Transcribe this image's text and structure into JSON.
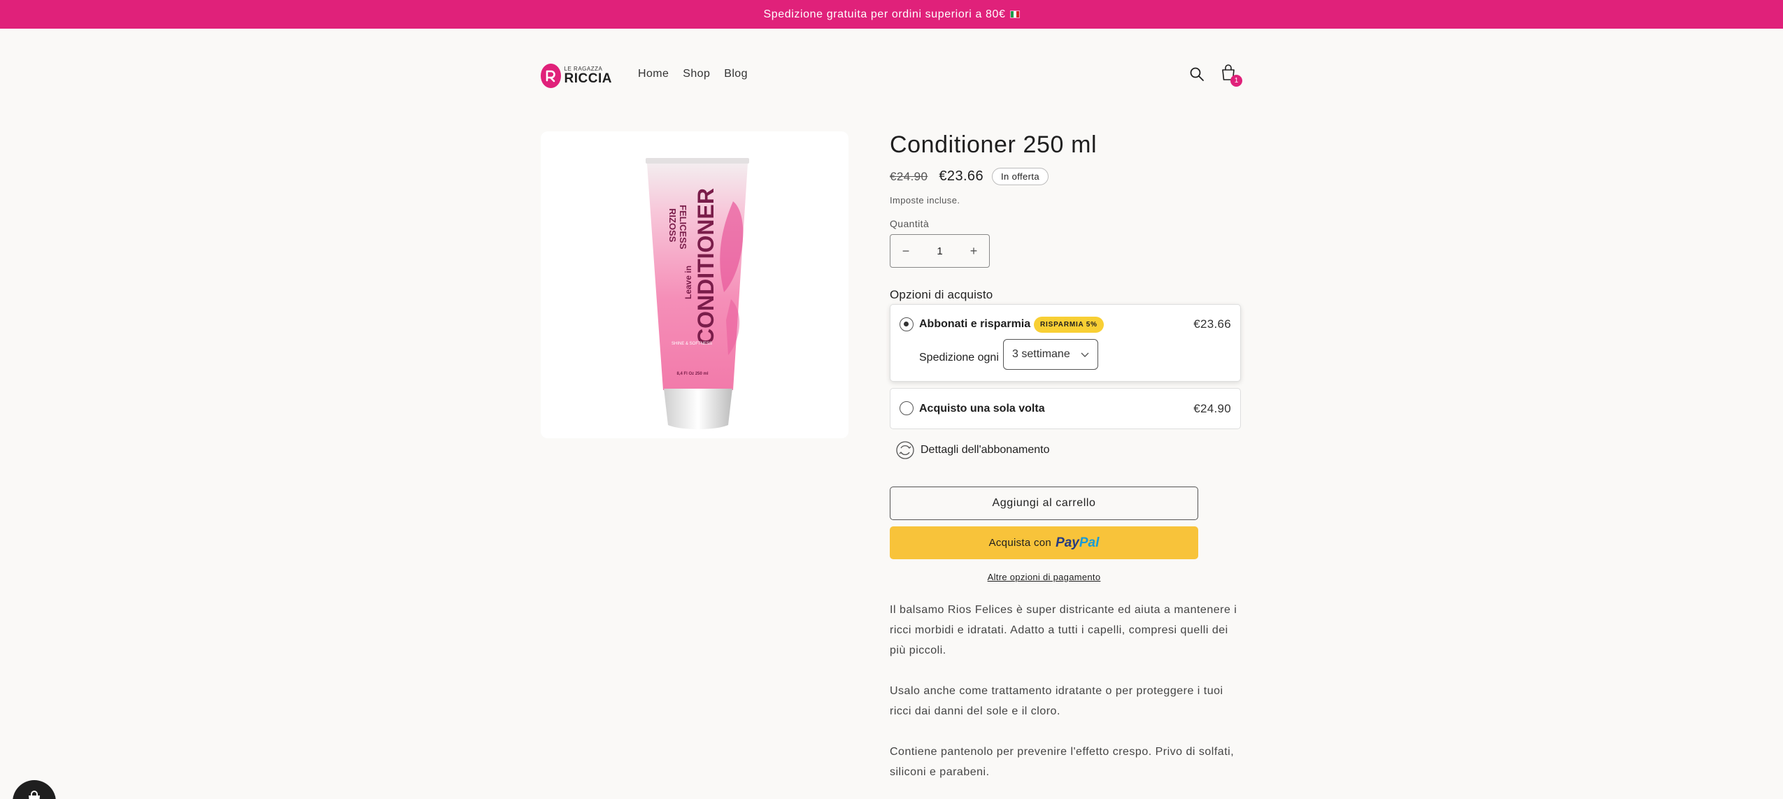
{
  "announcement": {
    "text": "Spedizione gratuita per ordini superiori a 80€"
  },
  "colors": {
    "accent": "#e0217a",
    "paypal": "#f8c33a",
    "save_badge": "#f8cf34"
  },
  "brand": {
    "small": "LE RAGAZZA",
    "big": "RICCIA"
  },
  "nav": [
    {
      "label": "Home"
    },
    {
      "label": "Shop"
    },
    {
      "label": "Blog"
    }
  ],
  "header": {
    "search_icon": "search-icon",
    "cart_icon": "cart-icon",
    "cart_count": "1"
  },
  "product": {
    "image": {
      "brand_line1": "RIZOSS",
      "brand_line2": "FELICESS",
      "product_line1": "Leave in",
      "product_line2": "CONDITIONER",
      "tag": "SHINE & SOFTNESS",
      "volume": "8,4 Fl Oz   250 ml"
    },
    "title": "Conditioner 250 ml",
    "price_old": "€24.90",
    "price_new": "€23.66",
    "sale_badge": "In offerta",
    "tax_note": "Imposte incluse.",
    "qty_label": "Quantità",
    "qty_value": "1",
    "qty_minus": "−",
    "qty_plus": "+"
  },
  "purchase_options": {
    "label": "Opzioni di acquisto",
    "subscription": {
      "title": "Abbonati e risparmia",
      "badge": "RISPARMIA 5%",
      "price": "€23.66",
      "frequency_label": "Spedizione ogni",
      "frequency_value": "3 settimane",
      "selected": true
    },
    "one_time": {
      "title": "Acquisto una sola volta",
      "price": "€24.90",
      "selected": false
    },
    "details_link": "Dettagli dell'abbonamento"
  },
  "buttons": {
    "add_to_cart": "Aggiungi al carrello",
    "paypal_prefix": "Acquista con",
    "paypal_logo_a": "Pay",
    "paypal_logo_b": "Pal",
    "more_payment": "Altre opzioni di pagamento"
  },
  "description": [
    "Il balsamo Rios Felices è super districante ed aiuta a mantenere i ricci morbidi e idratati. Adatto a tutti i capelli, compresi quelli dei più piccoli.",
    "Usalo anche come trattamento idratante o per proteggere i tuoi ricci dai danni del sole e il cloro.",
    "Contiene pantenolo per prevenire l'effetto crespo. Privo di solfati, siliconi e parabeni."
  ]
}
